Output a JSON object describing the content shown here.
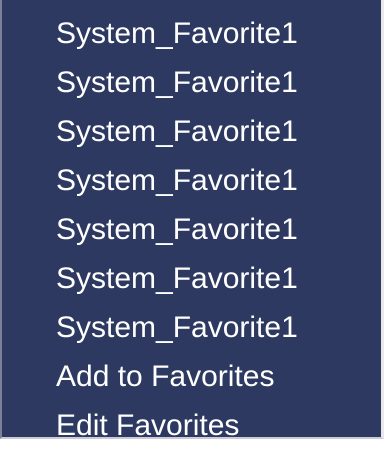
{
  "menu": {
    "items": [
      {
        "label": "System_Favorite1"
      },
      {
        "label": "System_Favorite1"
      },
      {
        "label": "System_Favorite1"
      },
      {
        "label": "System_Favorite1"
      },
      {
        "label": "System_Favorite1"
      },
      {
        "label": "System_Favorite1"
      },
      {
        "label": "System_Favorite1"
      },
      {
        "label": "Add to Favorites"
      },
      {
        "label": "Edit Favorites"
      }
    ],
    "colors": {
      "background": "#2d3960",
      "text": "#ffffff"
    }
  }
}
